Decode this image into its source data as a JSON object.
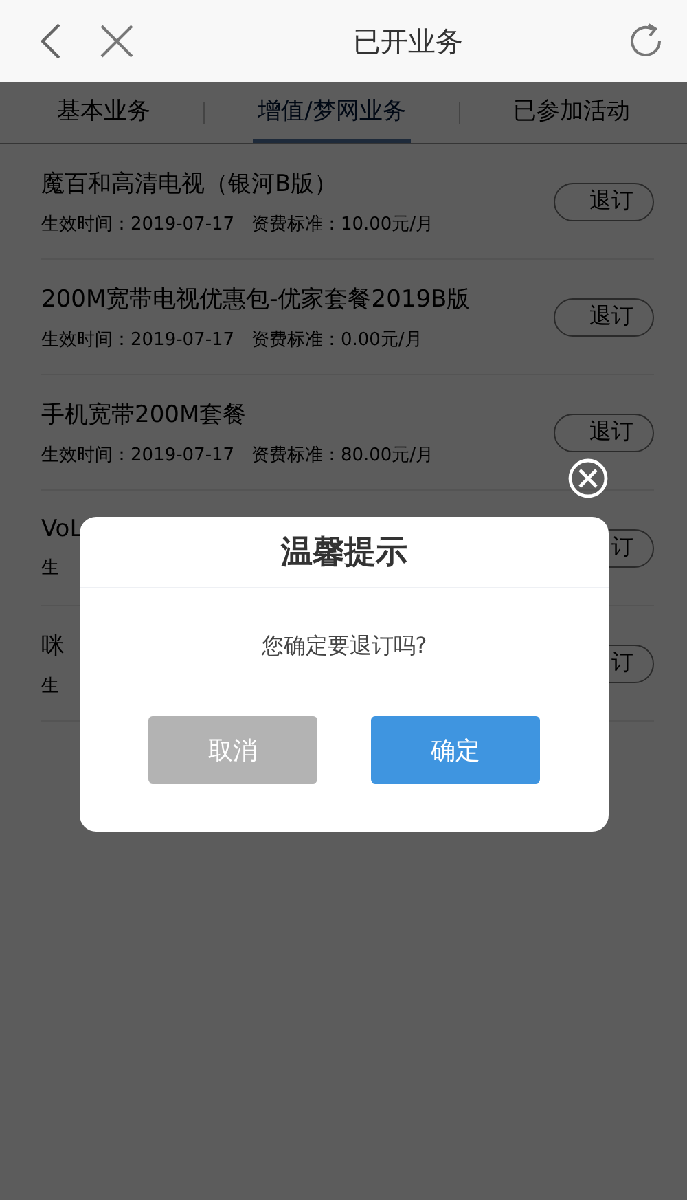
{
  "header": {
    "title": "已开业务"
  },
  "tabs": [
    {
      "label": "基本业务",
      "selected": false
    },
    {
      "label": "增值/梦网业务",
      "selected": true
    },
    {
      "label": "已参加活动",
      "selected": false
    }
  ],
  "services": [
    {
      "name": "魔百和高清电视（银河B版）",
      "detail": "生效时间：2019-07-17   资费标准：10.00元/月",
      "action": "退订"
    },
    {
      "name": "200M宽带电视优惠包-优家套餐2019B版",
      "detail": "生效时间：2019-07-17   资费标准：0.00元/月",
      "action": "退订"
    },
    {
      "name": "手机宽带200M套餐",
      "detail": "生效时间：2019-07-17   资费标准：80.00元/月",
      "action": "退订"
    },
    {
      "name": "VoL",
      "detail": "生",
      "action": "订"
    },
    {
      "name": "咪",
      "detail": "生",
      "action": "订"
    }
  ],
  "dialog": {
    "title": "温馨提示",
    "message": "您确定要退订吗?",
    "buttons": [
      {
        "label": "取消",
        "kind": "cancel"
      },
      {
        "label": "确定",
        "kind": "confirm"
      }
    ]
  }
}
